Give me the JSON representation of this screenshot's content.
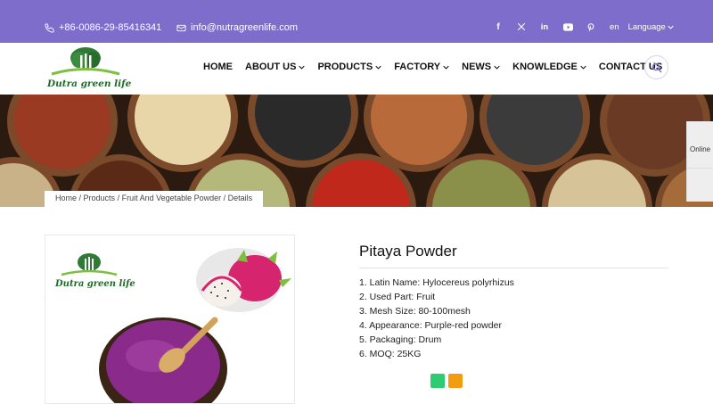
{
  "topbar": {
    "phone": "+86-0086-29-85416341",
    "email": "info@nutragreenlife.com",
    "social": [
      "facebook-icon",
      "x-twitter-icon",
      "linkedin-icon",
      "youtube-icon",
      "pinterest-icon"
    ],
    "lang_code": "en",
    "language_label": "Language"
  },
  "header": {
    "logo_text": "Dutra green life",
    "nav": [
      {
        "label": "HOME",
        "dropdown": false
      },
      {
        "label": "ABOUT US",
        "dropdown": true
      },
      {
        "label": "PRODUCTS",
        "dropdown": true
      },
      {
        "label": "FACTORY",
        "dropdown": true
      },
      {
        "label": "NEWS",
        "dropdown": true
      },
      {
        "label": "KNOWLEDGE",
        "dropdown": true
      },
      {
        "label": "CONTACT US",
        "dropdown": false
      }
    ]
  },
  "breadcrumb": {
    "items": [
      "Home",
      "Products",
      "Fruit And Vegetable Powder",
      "Details"
    ],
    "separator": " / "
  },
  "sidebar_widget": {
    "online_label": "Online"
  },
  "product": {
    "image_logo_text": "Dutra green life",
    "title": "Pitaya Powder",
    "specs": [
      "1. Latin Name: Hylocereus polyrhizus",
      "2. Used Part: Fruit",
      "3. Mesh Size: 80-100mesh",
      "4. Appearance: Purple-red powder",
      "5. Packaging: Drum",
      "6. MOQ: 25KG"
    ]
  },
  "colors": {
    "brand_purple": "#7f6dcc",
    "logo_green": "#1f6a2b",
    "button_green": "#2ecc71",
    "button_orange": "#f39c12",
    "powder_purple": "#8a2a8a"
  }
}
